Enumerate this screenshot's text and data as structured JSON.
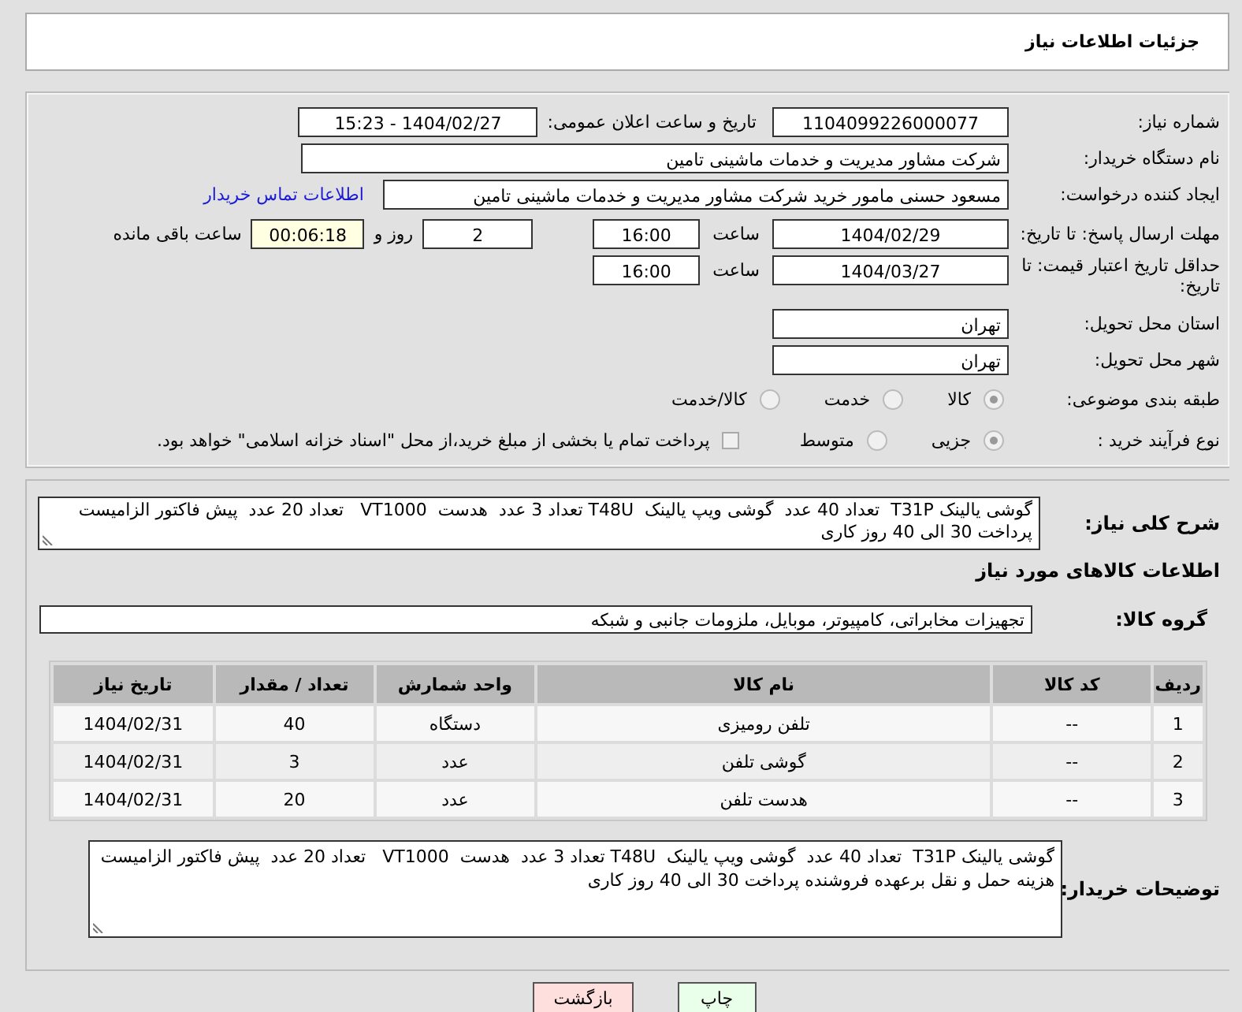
{
  "header": {
    "title": "جزئیات اطلاعات نیاز"
  },
  "form": {
    "need_number": {
      "label": "شماره نیاز:",
      "value": "1104099226000077"
    },
    "announce": {
      "label": "تاریخ و ساعت اعلان عمومی:",
      "value": "1404/02/27 - 15:23"
    },
    "buyer_org": {
      "label": "نام دستگاه خریدار:",
      "value": "شرکت مشاور مدیریت و خدمات ماشینی تامین"
    },
    "requester": {
      "label": "ایجاد کننده درخواست:",
      "value": "مسعود حسنی مامور خرید شرکت مشاور مدیریت و خدمات ماشینی تامین",
      "link": "اطلاعات تماس خریدار"
    },
    "deadline": {
      "label": "مهلت ارسال پاسخ: تا تاریخ:",
      "date": "1404/02/29",
      "time_label": "ساعت",
      "time": "16:00",
      "days": "2",
      "days_label": "روز و",
      "remaining": "00:06:18",
      "remaining_label": "ساعت باقی مانده"
    },
    "validity": {
      "label": "حداقل تاریخ اعتبار قیمت: تا تاریخ:",
      "date": "1404/03/27",
      "time_label": "ساعت",
      "time": "16:00"
    },
    "province": {
      "label": "استان محل تحویل:",
      "value": "تهران"
    },
    "city": {
      "label": "شهر محل تحویل:",
      "value": "تهران"
    },
    "category": {
      "label": "طبقه بندی موضوعی:",
      "options": [
        {
          "label": "کالا",
          "selected": true
        },
        {
          "label": "خدمت",
          "selected": false
        },
        {
          "label": "کالا/خدمت",
          "selected": false
        }
      ]
    },
    "process": {
      "label": "نوع فرآیند خرید :",
      "options": [
        {
          "label": "جزیی",
          "selected": true
        },
        {
          "label": "متوسط",
          "selected": false
        }
      ],
      "treasury": {
        "label": "پرداخت تمام یا بخشی از مبلغ خرید،از محل \"اسناد خزانه اسلامی\" خواهد بود.",
        "checked": false
      }
    }
  },
  "items": {
    "description": {
      "label": "شرح کلی نیاز:",
      "value": "گوشی یالینک T31P  تعداد 40 عدد  گوشی ویپ یالینک  T48U تعداد 3 عدد  هدست  VT1000   تعداد 20 عدد  پیش فاکتور الزامیست  پرداخت 30 الی 40 روز کاری"
    },
    "heading": "اطلاعات کالاهای مورد نیاز",
    "group": {
      "label": "گروه کالا:",
      "value": "تجهیزات مخابراتی، کامپیوتر، موبایل، ملزومات جانبی و شبکه"
    },
    "table": {
      "columns": [
        "ردیف",
        "کد کالا",
        "نام کالا",
        "واحد شمارش",
        "تعداد / مقدار",
        "تاریخ نیاز"
      ],
      "rows": [
        [
          "1",
          "--",
          "تلفن رومیزی",
          "دستگاه",
          "40",
          "1404/02/31"
        ],
        [
          "2",
          "--",
          "گوشی تلفن",
          "عدد",
          "3",
          "1404/02/31"
        ],
        [
          "3",
          "--",
          "هدست تلفن",
          "عدد",
          "20",
          "1404/02/31"
        ]
      ]
    },
    "notes": {
      "label": "توضیحات خریدار:",
      "value": "گوشی یالینک T31P  تعداد 40 عدد  گوشی ویپ یالینک  T48U تعداد 3 عدد  هدست  VT1000   تعداد 20 عدد  پیش فاکتور الزامیست هزینه حمل و نقل برعهده فروشنده پرداخت 30 الی 40 روز کاری"
    }
  },
  "buttons": [
    {
      "label": "چاپ",
      "kind": "print"
    },
    {
      "label": "بازگشت",
      "kind": "back"
    }
  ]
}
